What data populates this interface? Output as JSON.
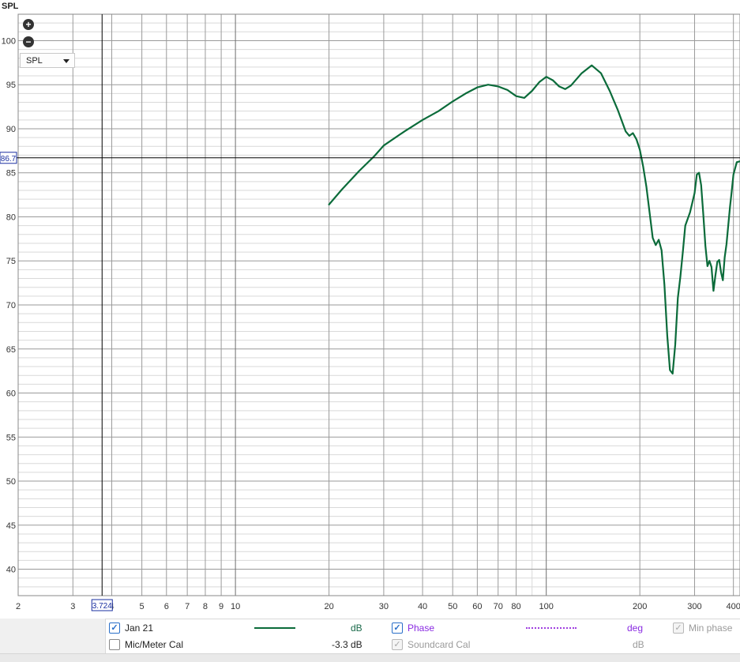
{
  "chart_data": {
    "type": "line",
    "title": "SPL",
    "x_scale": "log",
    "xlim": [
      2,
      420
    ],
    "ylim": [
      37,
      103
    ],
    "x_ticks": [
      2,
      3,
      4,
      5,
      6,
      7,
      8,
      9,
      10,
      20,
      30,
      40,
      50,
      60,
      70,
      80,
      100,
      200,
      300,
      400
    ],
    "x_tick_labels": [
      "2",
      "3",
      "4",
      "5",
      "6",
      "7",
      "8",
      "9",
      "10",
      "20",
      "30",
      "40",
      "50",
      "60",
      "70",
      "80",
      "100",
      "200",
      "300",
      "400"
    ],
    "y_ticks": [
      40,
      45,
      50,
      55,
      60,
      65,
      70,
      75,
      80,
      85,
      90,
      95,
      100
    ],
    "y_tick_labels": [
      "40",
      "45",
      "50",
      "55",
      "60",
      "65",
      "70",
      "75",
      "80",
      "85",
      "90",
      "95",
      "100"
    ],
    "grid": true,
    "cursor": {
      "x": 3.724,
      "y": 86.7,
      "x_label": "3.724",
      "y_label": "86.7"
    },
    "series": [
      {
        "name": "Jan 21",
        "color": "#0b6b3a",
        "x": [
          20,
          22,
          25,
          28,
          30,
          35,
          40,
          45,
          50,
          55,
          60,
          65,
          70,
          75,
          80,
          85,
          90,
          95,
          100,
          105,
          110,
          115,
          120,
          130,
          140,
          150,
          160,
          170,
          180,
          185,
          190,
          195,
          200,
          205,
          210,
          215,
          220,
          225,
          230,
          235,
          240,
          245,
          250,
          255,
          260,
          265,
          270,
          275,
          280,
          290,
          300,
          305,
          310,
          315,
          320,
          325,
          330,
          335,
          340,
          345,
          350,
          355,
          360,
          365,
          370,
          375,
          380,
          385,
          390,
          395,
          400,
          410,
          420
        ],
        "values": [
          81.4,
          83.1,
          85.2,
          86.9,
          88.1,
          89.7,
          91.0,
          92.0,
          93.1,
          94.0,
          94.7,
          95.0,
          94.8,
          94.4,
          93.7,
          93.5,
          94.3,
          95.3,
          95.9,
          95.5,
          94.8,
          94.5,
          94.9,
          96.3,
          97.2,
          96.3,
          94.3,
          92.1,
          89.7,
          89.2,
          89.5,
          88.8,
          87.6,
          85.7,
          83.4,
          80.5,
          77.6,
          76.8,
          77.4,
          76.2,
          72.3,
          66.5,
          62.6,
          62.2,
          65.5,
          70.8,
          73.2,
          76.0,
          79.0,
          80.5,
          82.7,
          84.8,
          85.0,
          83.6,
          80.3,
          76.7,
          74.4,
          75.0,
          74.3,
          71.6,
          73.3,
          74.9,
          75.1,
          73.7,
          72.8,
          75.4,
          76.9,
          79.0,
          81.1,
          82.9,
          84.8,
          86.2,
          86.3
        ]
      }
    ]
  },
  "controls": {
    "zoom_in_symbol": "+",
    "zoom_out_symbol": "−",
    "select_value": "SPL"
  },
  "legend": {
    "rows": [
      {
        "checked": true,
        "disabled": false,
        "label": "Jan 21",
        "value": "",
        "unit": "dB",
        "unit_color": "#1a6a4a"
      },
      {
        "checked": false,
        "disabled": false,
        "label": "Mic/Meter Cal",
        "value": "-3.3 dB",
        "unit": "",
        "unit_color": "#333333"
      }
    ],
    "phase": {
      "checked": true,
      "label": "Phase",
      "unit": "deg",
      "color": "#8a2be2"
    },
    "soundcard": {
      "checked": true,
      "disabled": true,
      "label": "Soundcard Cal",
      "unit": "dB"
    },
    "min_phase": {
      "checked": true,
      "disabled": true,
      "label": "Min phase"
    }
  },
  "colors": {
    "major_grid": "#9a9a9a",
    "minor_grid": "#d9d9d9",
    "cursor": "#000000",
    "cursor_label": "#1a2fa0"
  }
}
